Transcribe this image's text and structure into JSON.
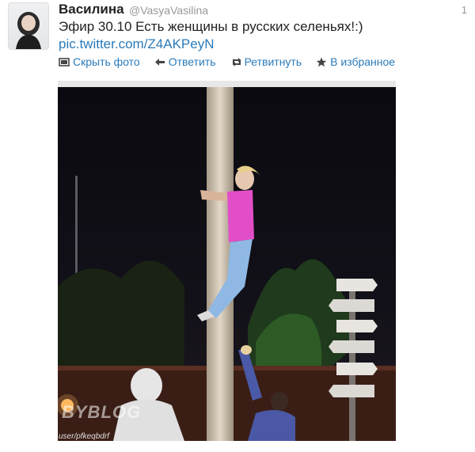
{
  "tweet": {
    "author_name": "Василина",
    "author_handle": "@VasyaVasilina",
    "time": "1",
    "text": "Эфир 30.10 Есть женщины в русских селеньях!:)",
    "link": "pic.twitter.com/Z4AKPeyN"
  },
  "actions": [
    {
      "label": "Скрыть фото",
      "icon": "photo-icon"
    },
    {
      "label": "Ответить",
      "icon": "reply-icon"
    },
    {
      "label": "Ретвитнуть",
      "icon": "retweet-icon"
    },
    {
      "label": "В избранное",
      "icon": "star-icon"
    }
  ],
  "photo": {
    "watermark_text": "BYBLOG",
    "watermark_url": "user/pfkeqbdrf"
  },
  "colors": {
    "link": "#2b7bb9",
    "text": "#222222",
    "muted": "#999999"
  }
}
